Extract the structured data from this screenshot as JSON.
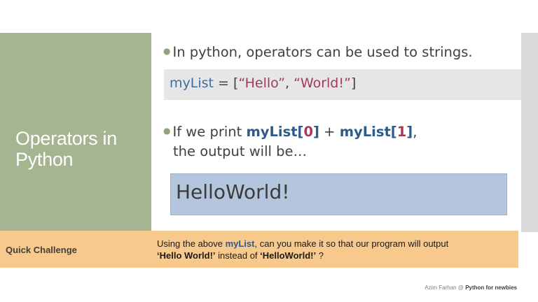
{
  "slide": {
    "title": "Operators in Python",
    "bullet1": "In python, operators can be used to strings.",
    "code": {
      "var": "myList",
      "assign": " = [",
      "str1": "“Hello”",
      "sep": ", ",
      "str2": "“World!”",
      "close": "]"
    },
    "bullet2": {
      "prefix": "If we print ",
      "var1": "myList",
      "open1": "[",
      "idx1": "0",
      "close1": "]",
      "plus": " + ",
      "var2": "myList",
      "open2": "[",
      "idx2": "1",
      "close2": "]",
      "suffix": ",",
      "line2": "the output will be…"
    },
    "output": "HelloWorld!"
  },
  "challenge": {
    "label": "Quick Challenge",
    "text_prefix": "Using the above ",
    "var": "myList",
    "text_mid": ", can you make it so that our program will output",
    "quote1": "‘Hello World!’",
    "instead": " instead of ",
    "quote2": "‘HelloWorld!’",
    "end": " ?"
  },
  "footer": {
    "author": "Azim Farhan @ ",
    "course": "Python for newbies"
  },
  "colors": {
    "green_panel": "#a5b592",
    "challenge_bar": "#f8c98c",
    "output_box": "#b4c6dd",
    "code_box": "#e6e6e6",
    "keyword": "#2e5a8c",
    "string": "#a33b57"
  }
}
